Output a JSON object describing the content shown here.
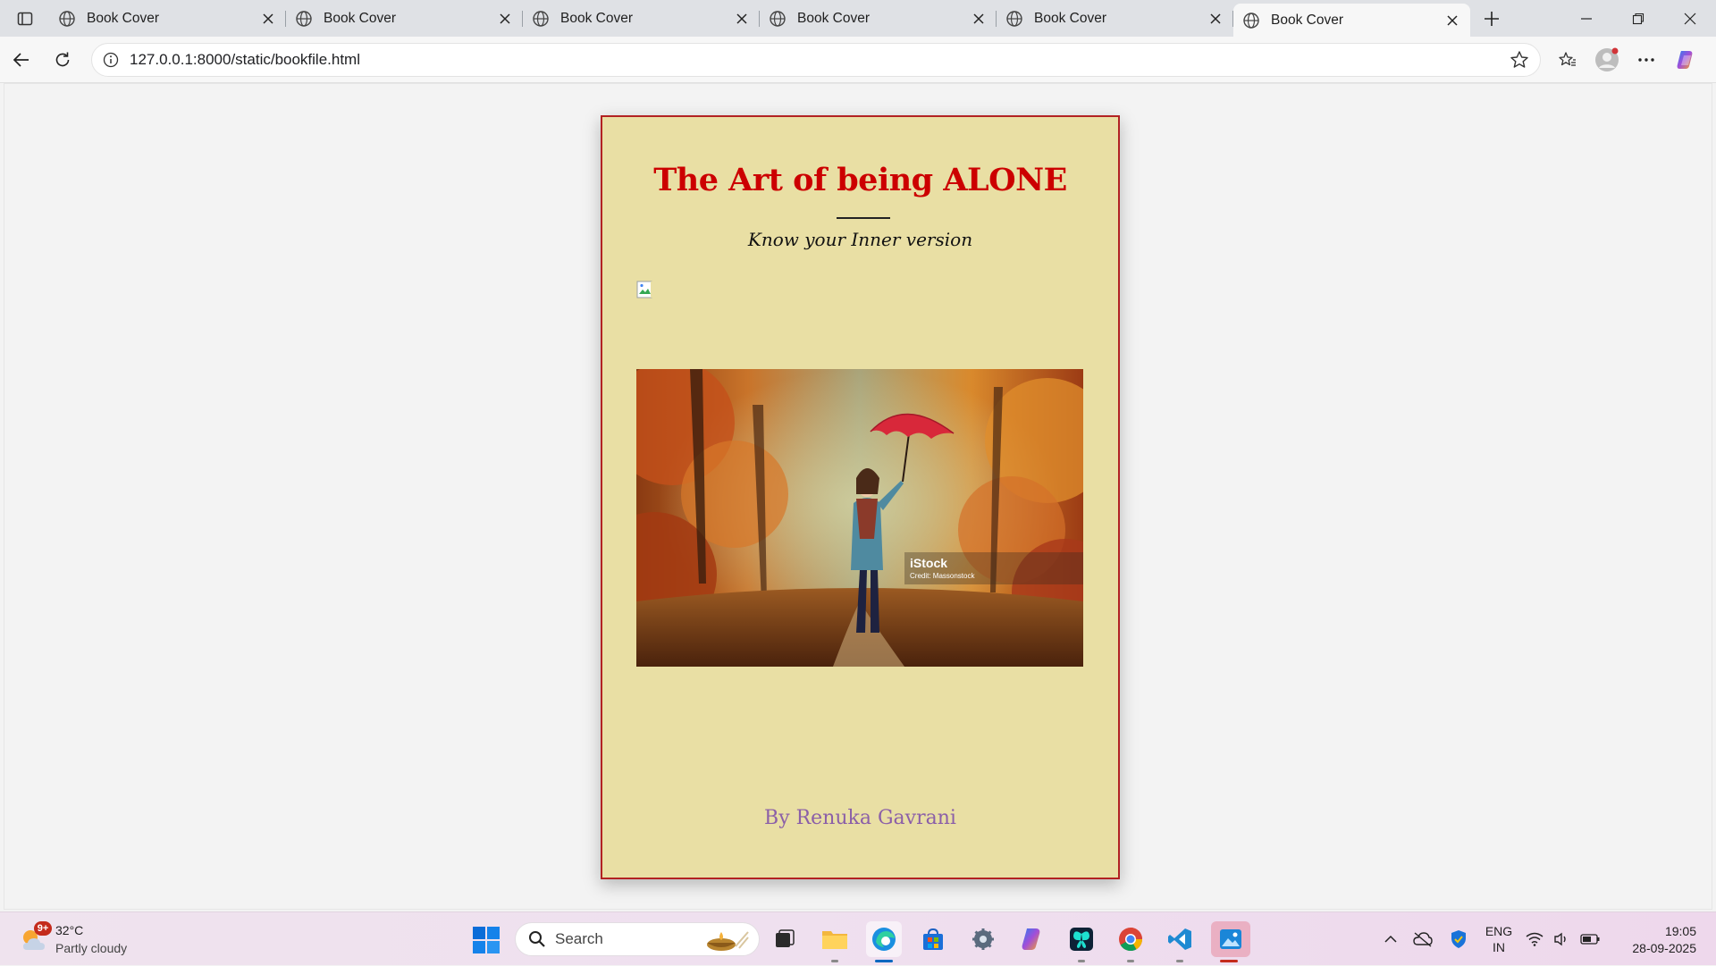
{
  "browser": {
    "tabs": [
      {
        "title": "Book Cover",
        "active": false
      },
      {
        "title": "Book Cover",
        "active": false
      },
      {
        "title": "Book Cover",
        "active": false
      },
      {
        "title": "Book Cover",
        "active": false
      },
      {
        "title": "Book Cover",
        "active": false
      },
      {
        "title": "Book Cover",
        "active": true
      }
    ],
    "url": "127.0.0.1:8000/static/bookfile.html"
  },
  "book": {
    "title": "The Art of being ALONE",
    "subtitle": "Know your Inner version",
    "photo_watermark": "iStock",
    "photo_credit": "Credit: Massonstock",
    "author": "By Renuka Gavrani",
    "colors": {
      "background": "#e9dfa4",
      "border": "#b22222",
      "title": "#cc0000",
      "author": "#8b5fa8"
    }
  },
  "taskbar": {
    "weather_temp": "32°C",
    "weather_desc": "Partly cloudy",
    "weather_badge": "9+",
    "search_label": "Search",
    "lang_top": "ENG",
    "lang_bottom": "IN",
    "time": "19:05",
    "date": "28-09-2025"
  }
}
